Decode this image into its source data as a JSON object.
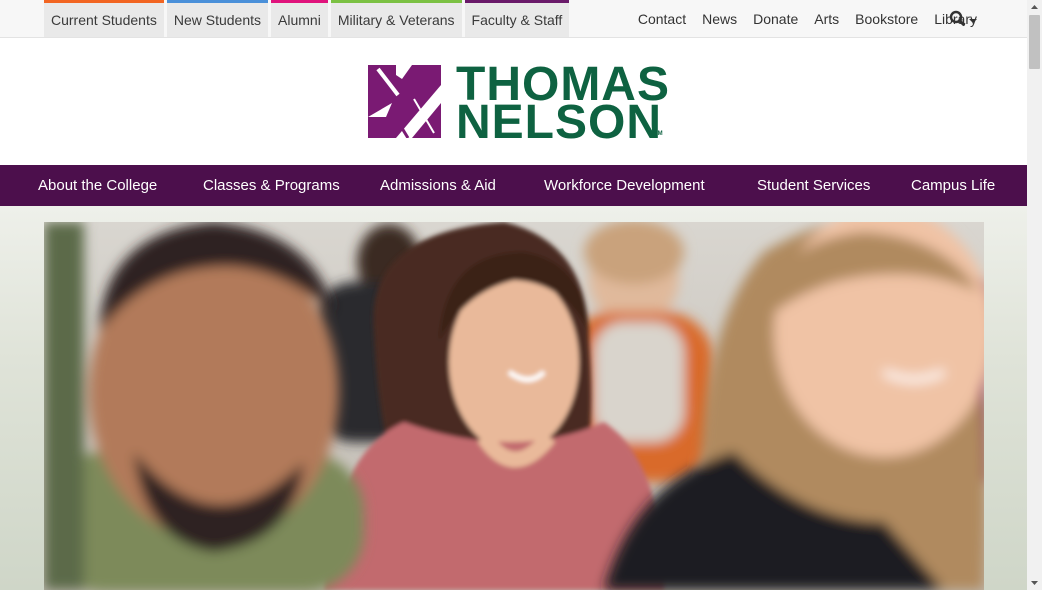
{
  "audience_tabs": [
    {
      "label": "Current Students",
      "color": "#f26522"
    },
    {
      "label": "New Students",
      "color": "#4a90d9"
    },
    {
      "label": "Alumni",
      "color": "#e0137c"
    },
    {
      "label": "Military & Veterans",
      "color": "#7bc143"
    },
    {
      "label": "Faculty & Staff",
      "color": "#6a1a6a"
    }
  ],
  "utility_links": [
    "Contact",
    "News",
    "Donate",
    "Arts",
    "Bookstore",
    "Library"
  ],
  "search": {
    "icon": "search-icon",
    "caret": "caret-down-icon"
  },
  "logo": {
    "line1": "THOMAS",
    "line2": "NELSON",
    "tm": "TM",
    "brand_green": "#0e6241",
    "brand_purple": "#7a1a73"
  },
  "main_nav": [
    "About the College",
    "Classes & Programs",
    "Admissions & Aid",
    "Workforce Development",
    "Student Services",
    "Campus Life"
  ],
  "colors": {
    "nav_background": "#4c0f4c"
  }
}
